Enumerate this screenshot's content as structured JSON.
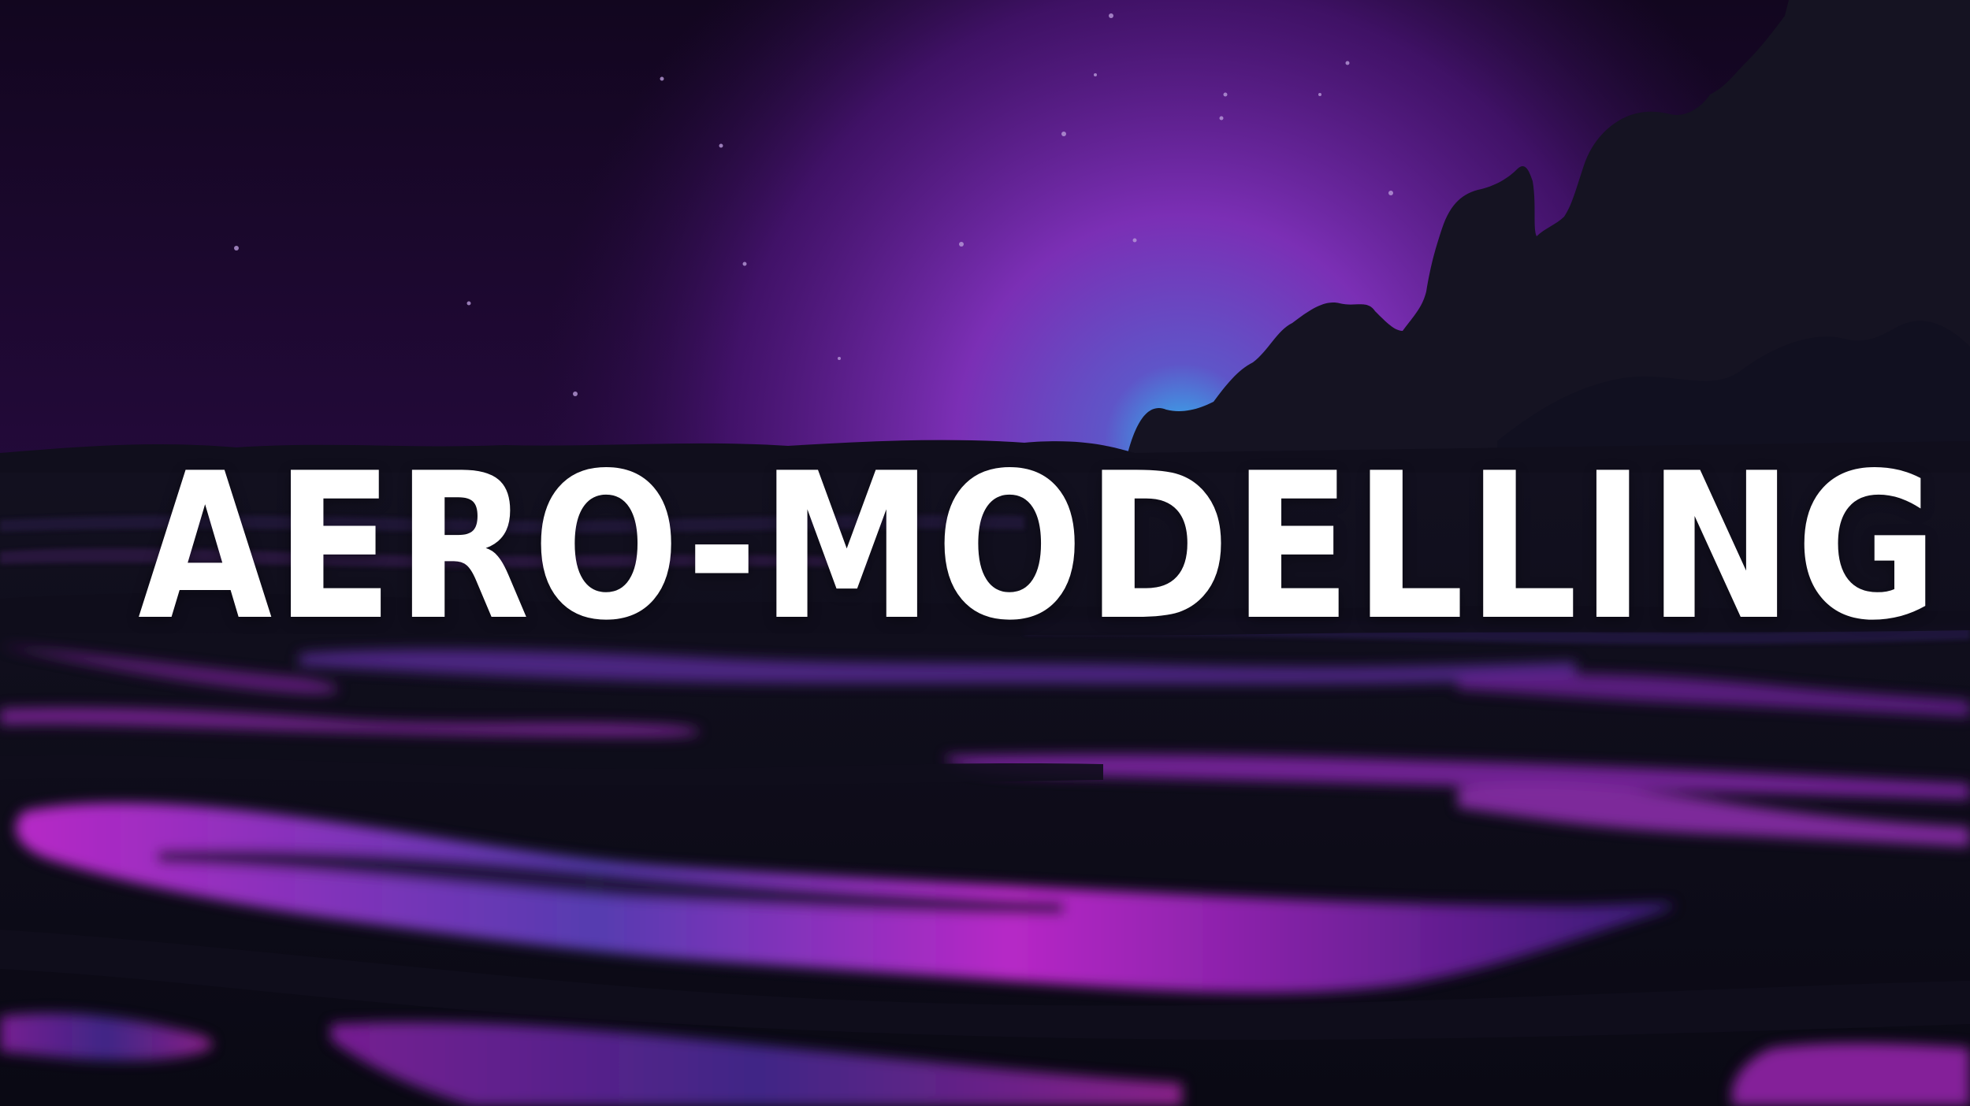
{
  "banner": {
    "title": "AERO-MODELLING"
  },
  "scene": {
    "sky_top_color": "#12061f",
    "sky_glow_color": "#7b2fb5",
    "horizon_glow_color": "#2aa6e8",
    "terrain_color": "#0e0c1a",
    "reflection_color_magenta": "#c02ad0",
    "reflection_color_violet": "#5a3fb8"
  }
}
